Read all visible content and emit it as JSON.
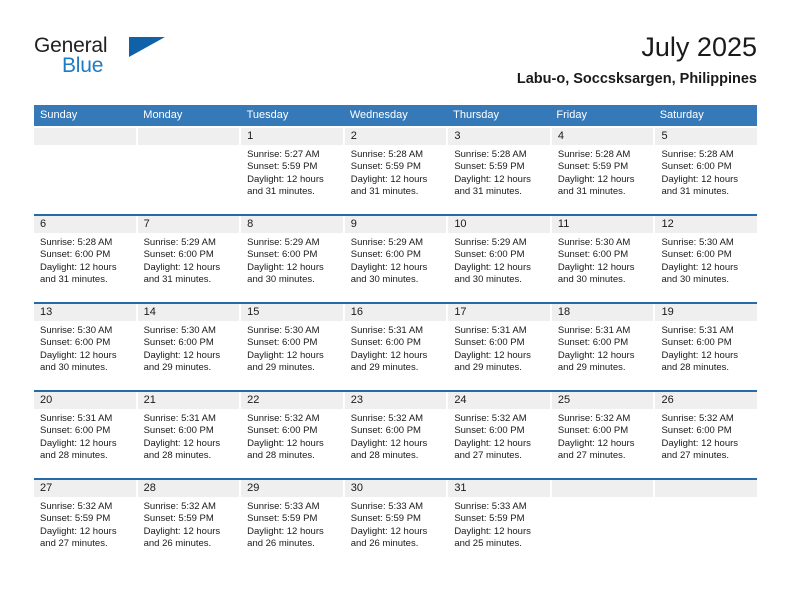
{
  "brand": {
    "name_part1": "General",
    "name_part2": "Blue",
    "primary_color": "#1e7bc4",
    "triangle_color": "#0f62a8"
  },
  "header": {
    "title": "July 2025",
    "subtitle": "Labu-o, Soccsksargen, Philippines"
  },
  "calendar": {
    "header_color": "#3579b8",
    "row_divider_color": "#2869a8",
    "day_band_color": "#efefef",
    "weekdays": [
      "Sunday",
      "Monday",
      "Tuesday",
      "Wednesday",
      "Thursday",
      "Friday",
      "Saturday"
    ],
    "weeks": [
      [
        {
          "day": "",
          "lines": []
        },
        {
          "day": "",
          "lines": []
        },
        {
          "day": "1",
          "lines": [
            "Sunrise: 5:27 AM",
            "Sunset: 5:59 PM",
            "Daylight: 12 hours",
            "and 31 minutes."
          ]
        },
        {
          "day": "2",
          "lines": [
            "Sunrise: 5:28 AM",
            "Sunset: 5:59 PM",
            "Daylight: 12 hours",
            "and 31 minutes."
          ]
        },
        {
          "day": "3",
          "lines": [
            "Sunrise: 5:28 AM",
            "Sunset: 5:59 PM",
            "Daylight: 12 hours",
            "and 31 minutes."
          ]
        },
        {
          "day": "4",
          "lines": [
            "Sunrise: 5:28 AM",
            "Sunset: 5:59 PM",
            "Daylight: 12 hours",
            "and 31 minutes."
          ]
        },
        {
          "day": "5",
          "lines": [
            "Sunrise: 5:28 AM",
            "Sunset: 6:00 PM",
            "Daylight: 12 hours",
            "and 31 minutes."
          ]
        }
      ],
      [
        {
          "day": "6",
          "lines": [
            "Sunrise: 5:28 AM",
            "Sunset: 6:00 PM",
            "Daylight: 12 hours",
            "and 31 minutes."
          ]
        },
        {
          "day": "7",
          "lines": [
            "Sunrise: 5:29 AM",
            "Sunset: 6:00 PM",
            "Daylight: 12 hours",
            "and 31 minutes."
          ]
        },
        {
          "day": "8",
          "lines": [
            "Sunrise: 5:29 AM",
            "Sunset: 6:00 PM",
            "Daylight: 12 hours",
            "and 30 minutes."
          ]
        },
        {
          "day": "9",
          "lines": [
            "Sunrise: 5:29 AM",
            "Sunset: 6:00 PM",
            "Daylight: 12 hours",
            "and 30 minutes."
          ]
        },
        {
          "day": "10",
          "lines": [
            "Sunrise: 5:29 AM",
            "Sunset: 6:00 PM",
            "Daylight: 12 hours",
            "and 30 minutes."
          ]
        },
        {
          "day": "11",
          "lines": [
            "Sunrise: 5:30 AM",
            "Sunset: 6:00 PM",
            "Daylight: 12 hours",
            "and 30 minutes."
          ]
        },
        {
          "day": "12",
          "lines": [
            "Sunrise: 5:30 AM",
            "Sunset: 6:00 PM",
            "Daylight: 12 hours",
            "and 30 minutes."
          ]
        }
      ],
      [
        {
          "day": "13",
          "lines": [
            "Sunrise: 5:30 AM",
            "Sunset: 6:00 PM",
            "Daylight: 12 hours",
            "and 30 minutes."
          ]
        },
        {
          "day": "14",
          "lines": [
            "Sunrise: 5:30 AM",
            "Sunset: 6:00 PM",
            "Daylight: 12 hours",
            "and 29 minutes."
          ]
        },
        {
          "day": "15",
          "lines": [
            "Sunrise: 5:30 AM",
            "Sunset: 6:00 PM",
            "Daylight: 12 hours",
            "and 29 minutes."
          ]
        },
        {
          "day": "16",
          "lines": [
            "Sunrise: 5:31 AM",
            "Sunset: 6:00 PM",
            "Daylight: 12 hours",
            "and 29 minutes."
          ]
        },
        {
          "day": "17",
          "lines": [
            "Sunrise: 5:31 AM",
            "Sunset: 6:00 PM",
            "Daylight: 12 hours",
            "and 29 minutes."
          ]
        },
        {
          "day": "18",
          "lines": [
            "Sunrise: 5:31 AM",
            "Sunset: 6:00 PM",
            "Daylight: 12 hours",
            "and 29 minutes."
          ]
        },
        {
          "day": "19",
          "lines": [
            "Sunrise: 5:31 AM",
            "Sunset: 6:00 PM",
            "Daylight: 12 hours",
            "and 28 minutes."
          ]
        }
      ],
      [
        {
          "day": "20",
          "lines": [
            "Sunrise: 5:31 AM",
            "Sunset: 6:00 PM",
            "Daylight: 12 hours",
            "and 28 minutes."
          ]
        },
        {
          "day": "21",
          "lines": [
            "Sunrise: 5:31 AM",
            "Sunset: 6:00 PM",
            "Daylight: 12 hours",
            "and 28 minutes."
          ]
        },
        {
          "day": "22",
          "lines": [
            "Sunrise: 5:32 AM",
            "Sunset: 6:00 PM",
            "Daylight: 12 hours",
            "and 28 minutes."
          ]
        },
        {
          "day": "23",
          "lines": [
            "Sunrise: 5:32 AM",
            "Sunset: 6:00 PM",
            "Daylight: 12 hours",
            "and 28 minutes."
          ]
        },
        {
          "day": "24",
          "lines": [
            "Sunrise: 5:32 AM",
            "Sunset: 6:00 PM",
            "Daylight: 12 hours",
            "and 27 minutes."
          ]
        },
        {
          "day": "25",
          "lines": [
            "Sunrise: 5:32 AM",
            "Sunset: 6:00 PM",
            "Daylight: 12 hours",
            "and 27 minutes."
          ]
        },
        {
          "day": "26",
          "lines": [
            "Sunrise: 5:32 AM",
            "Sunset: 6:00 PM",
            "Daylight: 12 hours",
            "and 27 minutes."
          ]
        }
      ],
      [
        {
          "day": "27",
          "lines": [
            "Sunrise: 5:32 AM",
            "Sunset: 5:59 PM",
            "Daylight: 12 hours",
            "and 27 minutes."
          ]
        },
        {
          "day": "28",
          "lines": [
            "Sunrise: 5:32 AM",
            "Sunset: 5:59 PM",
            "Daylight: 12 hours",
            "and 26 minutes."
          ]
        },
        {
          "day": "29",
          "lines": [
            "Sunrise: 5:33 AM",
            "Sunset: 5:59 PM",
            "Daylight: 12 hours",
            "and 26 minutes."
          ]
        },
        {
          "day": "30",
          "lines": [
            "Sunrise: 5:33 AM",
            "Sunset: 5:59 PM",
            "Daylight: 12 hours",
            "and 26 minutes."
          ]
        },
        {
          "day": "31",
          "lines": [
            "Sunrise: 5:33 AM",
            "Sunset: 5:59 PM",
            "Daylight: 12 hours",
            "and 25 minutes."
          ]
        },
        {
          "day": "",
          "lines": []
        },
        {
          "day": "",
          "lines": []
        }
      ]
    ]
  }
}
